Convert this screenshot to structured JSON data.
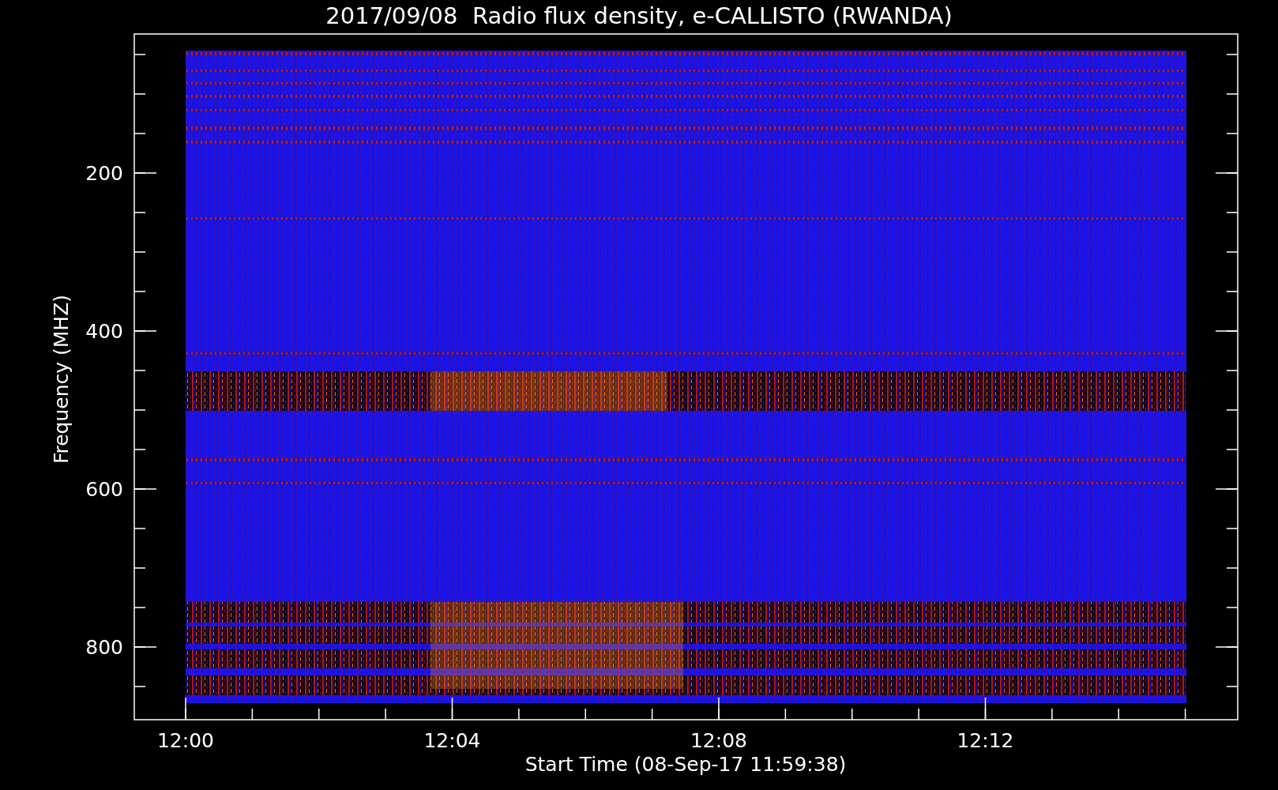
{
  "title": "2017/09/08  Radio flux density, e-CALLISTO (RWANDA)",
  "y_axis": {
    "label": "Frequency (MHZ)",
    "ticks": [
      "200",
      "400",
      "600",
      "800"
    ]
  },
  "x_axis": {
    "label": "Start Time (08-Sep-17 11:59:38)",
    "ticks": [
      "12:00",
      "12:04",
      "12:08",
      "12:12"
    ]
  }
}
